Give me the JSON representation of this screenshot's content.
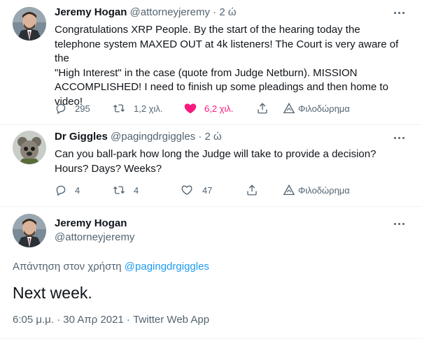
{
  "tweets": [
    {
      "display_name": "Jeremy Hogan",
      "handle": "@attorneyjeremy",
      "separator": "·",
      "age": "2 ώ",
      "text_lines": [
        "Congratulations XRP People.  By the start of the hearing today the",
        "telephone system MAXED OUT at 4k listeners! The Court is very aware of the",
        "\"High Interest\" in the case (quote from Judge Netburn).  MISSION",
        "ACCOMPLISHED! I need to finish up some pleadings and then home to",
        "video!"
      ],
      "replies": "295",
      "retweets": "1,2 χιλ.",
      "likes": "6,2 χιλ.",
      "promote_label": "Φιλοδώρημα",
      "liked": true
    },
    {
      "display_name": "Dr Giggles",
      "handle": "@pagingdrgiggles",
      "separator": "·",
      "age": "2 ώ",
      "text_lines": [
        "Can you ball-park how long the Judge will take to provide a decision?",
        "Hours? Days? Weeks?"
      ],
      "replies": "4",
      "retweets": "4",
      "likes": "47",
      "promote_label": "Φιλοδώρημα",
      "liked": false
    }
  ],
  "focused_tweet": {
    "display_name": "Jeremy Hogan",
    "handle": "@attorneyjeremy",
    "reply_prefix": "Απάντηση στον χρήστη",
    "reply_handle": "@pagingdrgiggles",
    "text": "Next week.",
    "timestamp": "6:05 μ.μ. · 30 Απρ 2021 · ",
    "client": "Twitter Web App"
  },
  "icons": {
    "reply": "reply-icon",
    "retweet": "retweet-icon",
    "like": "heart-icon",
    "share": "share-icon",
    "tip": "tip-icon",
    "more": "more-icon"
  },
  "colors": {
    "text": "#0f1419",
    "secondary": "#536471",
    "accent": "#1d9bf0",
    "like": "#f91880",
    "divider": "#eff3f4"
  }
}
